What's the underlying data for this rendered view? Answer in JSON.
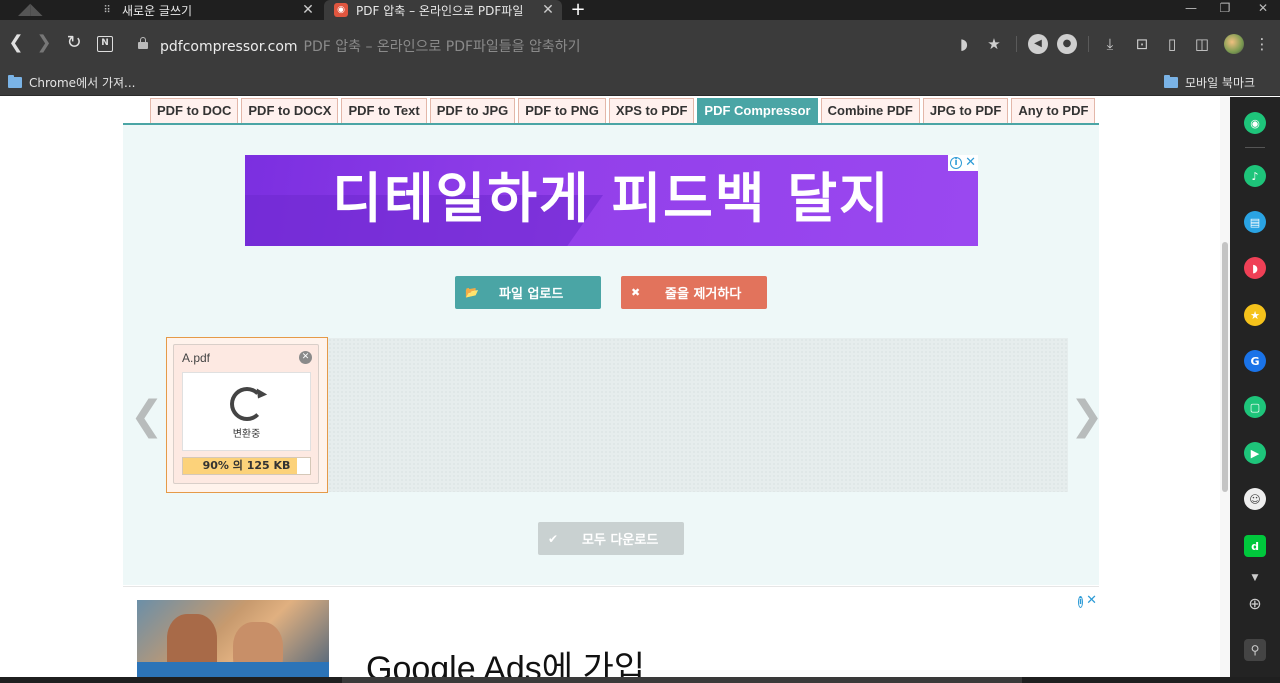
{
  "browser": {
    "tabs": [
      {
        "title": "새로운 글쓰기",
        "active": false
      },
      {
        "title": "PDF 압축 – 온라인으로 PDF파일",
        "active": true
      }
    ],
    "new_tab": "+",
    "url_domain": "pdfcompressor.com",
    "url_rest": "PDF 압축 – 온라인으로 PDF파일들을 압축하기",
    "bookmarks": {
      "left": "Chrome에서 가져...",
      "right": "모바일 북마크"
    }
  },
  "site": {
    "nav": [
      "PDF to DOC",
      "PDF to DOCX",
      "PDF to Text",
      "PDF to JPG",
      "PDF to PNG",
      "XPS to PDF",
      "PDF Compressor",
      "Combine PDF",
      "JPG to PDF",
      "Any to PDF"
    ],
    "active_nav": "PDF Compressor",
    "banner_text": "디테일하게 피드백 달지",
    "upload_label": "파일 업로드",
    "clear_label": "줄을 제거하다",
    "download_all_label": "모두 다운로드",
    "file": {
      "name": "A.pdf",
      "status": "변환중",
      "progress_text": "90% 의 125 KB",
      "progress": 0.9
    },
    "nav_prev": "❮",
    "nav_next": "❯",
    "ad_headline": "Google Ads에 가입"
  },
  "colors": {
    "accent": "#4aa5a5",
    "clear_button": "#e2735c",
    "banner": "#9340ea",
    "progress_fill": "#fcd27a"
  },
  "icons": {
    "back": "back-arrow-icon",
    "forward": "forward-arrow-icon",
    "reload": "reload-icon",
    "lock": "lock-icon",
    "star": "star-icon",
    "download": "download-icon",
    "folder": "folder-icon",
    "spinner": "refresh-icon"
  }
}
